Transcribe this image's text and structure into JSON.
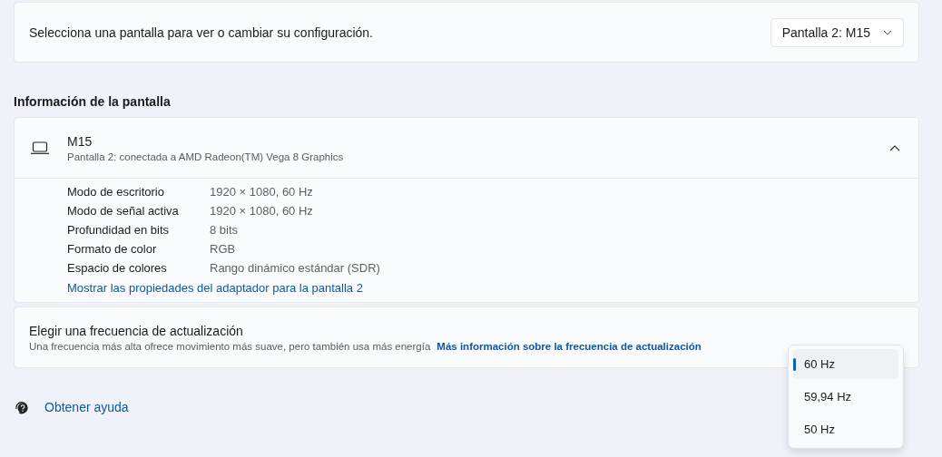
{
  "display_select": {
    "prompt": "Selecciona una pantalla para ver o cambiar su configuración.",
    "value": "Pantalla 2: M15"
  },
  "info_heading": "Información de la pantalla",
  "display_card": {
    "name": "M15",
    "subtitle": "Pantalla 2: conectada a AMD Radeon(TM) Vega 8 Graphics",
    "expanded": true,
    "properties": [
      {
        "label": "Modo de escritorio",
        "value": "1920 × 1080, 60 Hz"
      },
      {
        "label": "Modo de señal activa",
        "value": "1920 × 1080, 60 Hz"
      },
      {
        "label": "Profundidad en bits",
        "value": "8 bits"
      },
      {
        "label": "Formato de color",
        "value": "RGB"
      },
      {
        "label": "Espacio de colores",
        "value": "Rango dinámico estándar (SDR)"
      }
    ],
    "link": "Mostrar las propiedades del adaptador para la pantalla 2"
  },
  "refresh_rate": {
    "title": "Elegir una frecuencia de actualización",
    "description": "Una frecuencia más alta ofrece movimiento más suave, pero también usa más energía",
    "link": "Más información sobre la frecuencia de actualización",
    "options": [
      {
        "label": "60 Hz",
        "selected": true
      },
      {
        "label": "59,94 Hz",
        "selected": false
      },
      {
        "label": "50 Hz",
        "selected": false
      }
    ]
  },
  "help_link": "Obtener ayuda"
}
